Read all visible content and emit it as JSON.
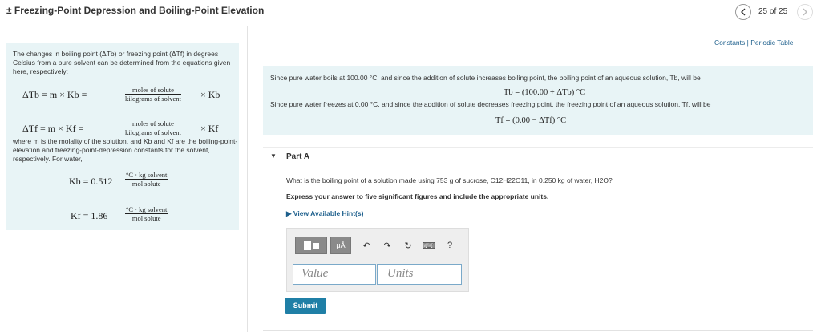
{
  "header": {
    "title": "± Freezing-Point Depression and Boiling-Point Elevation",
    "page_count": "25 of 25"
  },
  "left_panel": {
    "intro": "The changes in boiling point (ΔTb) or freezing point (ΔTf) in degrees Celsius from a pure solvent can be determined from the equations given here, respectively:",
    "eq_boil_lhs": "ΔTb = m × Kb =",
    "eq_boil_num": "moles of solute",
    "eq_boil_den": "kilograms of solvent",
    "eq_boil_rhs": "× Kb",
    "eq_freeze_lhs": "ΔTf = m × Kf =",
    "eq_freeze_num": "moles of solute",
    "eq_freeze_den": "kilograms of solvent",
    "eq_freeze_rhs": "× Kf",
    "where_text": "where m is the molality of the solution, and Kb and Kf are the boiling-point-elevation and freezing-point-depression constants for the solvent, respectively. For water,",
    "kb_lhs": "Kb = 0.512",
    "kb_num": "°C · kg solvent",
    "kb_den": "mol solute",
    "kf_lhs": "Kf = 1.86",
    "kf_num": "°C · kg solvent",
    "kf_den": "mol solute"
  },
  "links": {
    "constants": "Constants",
    "separator": "|",
    "periodic_table": "Periodic Table"
  },
  "info_box": {
    "boiling_text": "Since pure water boils at 100.00 °C, and since the addition of solute increases boiling point, the boiling point of an aqueous solution, Tb, will be",
    "boiling_eq": "Tb = (100.00 + ΔTb) °C",
    "freezing_text": "Since pure water freezes at 0.00 °C, and since the addition of solute decreases freezing point, the freezing point of an aqueous solution, Tf, will be",
    "freezing_eq": "Tf = (0.00 − ΔTf) °C"
  },
  "part": {
    "toggle": "▼",
    "title": "Part A",
    "question": "What is the boiling point of a solution made using 753 g of sucrose, C12H22O11, in 0.250 kg of water, H2O?",
    "instruction": "Express your answer to five significant figures and include the appropriate units.",
    "hints": "▶ View Available Hint(s)"
  },
  "editor": {
    "mu_label": "μÅ",
    "undo": "↶",
    "redo": "↷",
    "reset": "↻",
    "keyboard": "⌨",
    "help": "?",
    "value_placeholder": "Value",
    "units_placeholder": "Units"
  },
  "submit_label": "Submit"
}
